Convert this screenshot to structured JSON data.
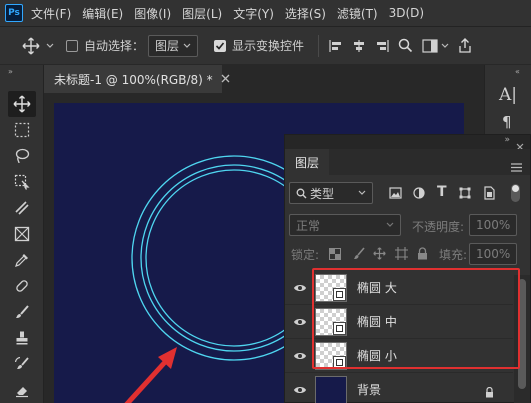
{
  "app": {
    "logo": "Ps"
  },
  "menu": [
    "文件(F)",
    "编辑(E)",
    "图像(I)",
    "图层(L)",
    "文字(Y)",
    "选择(S)",
    "滤镜(T)",
    "3D(D)"
  ],
  "options": {
    "auto_select_label": "自动选择：",
    "auto_select_checked": false,
    "auto_select_target": "图层",
    "show_transform_label": "显示变换控件",
    "show_transform_checked": true
  },
  "document": {
    "tab_title": "未标题-1 @ 100%(RGB/8) *"
  },
  "colors": {
    "canvas": "#161a4a",
    "circle_stroke": "#4fd6f0",
    "highlight": "#e03030",
    "arrow": "#e03030"
  },
  "layers_panel": {
    "tab_label": "图层",
    "filter_kind": "类型",
    "blend_mode": "正常",
    "opacity_label": "不透明度:",
    "opacity_value": "100%",
    "lock_label": "锁定:",
    "fill_label": "填充:",
    "fill_value": "100%",
    "layers": [
      {
        "name": "椭圆 大",
        "visible": true
      },
      {
        "name": "椭圆 中",
        "visible": true
      },
      {
        "name": "椭圆 小",
        "visible": true
      },
      {
        "name": "背景",
        "visible": true,
        "locked": true
      }
    ]
  }
}
